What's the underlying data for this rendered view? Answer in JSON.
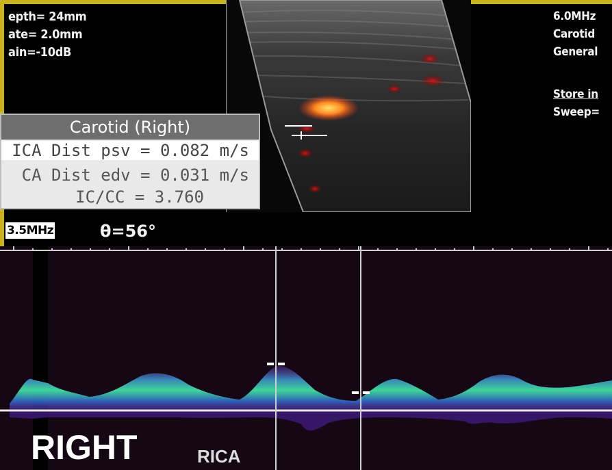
{
  "top_left": {
    "depth": "epth= 24mm",
    "rate": "ate= 2.0mm",
    "gain": "ain=-10dB"
  },
  "top_right": {
    "freq": "6.0MHz",
    "preset": "Carotid",
    "mode": "General",
    "store": "Store in",
    "sweep": "Sweep="
  },
  "measurement": {
    "title": "Carotid (Right)",
    "psv": "ICA Dist psv = 0.082 m/s",
    "edv": "CA Dist edv = 0.031 m/s",
    "ratio": "IC/CC = 3.760"
  },
  "doppler": {
    "freq_badge": "3.5MHz",
    "angle": "θ=56°"
  },
  "labels": {
    "side": "RIGHT",
    "vessel": "RICA"
  },
  "colors": {
    "frame": "#c9b320",
    "spectrum_low": "#5a2a9a",
    "spectrum_high": "#40e0a0",
    "color_flow": "#ff6a1a"
  }
}
